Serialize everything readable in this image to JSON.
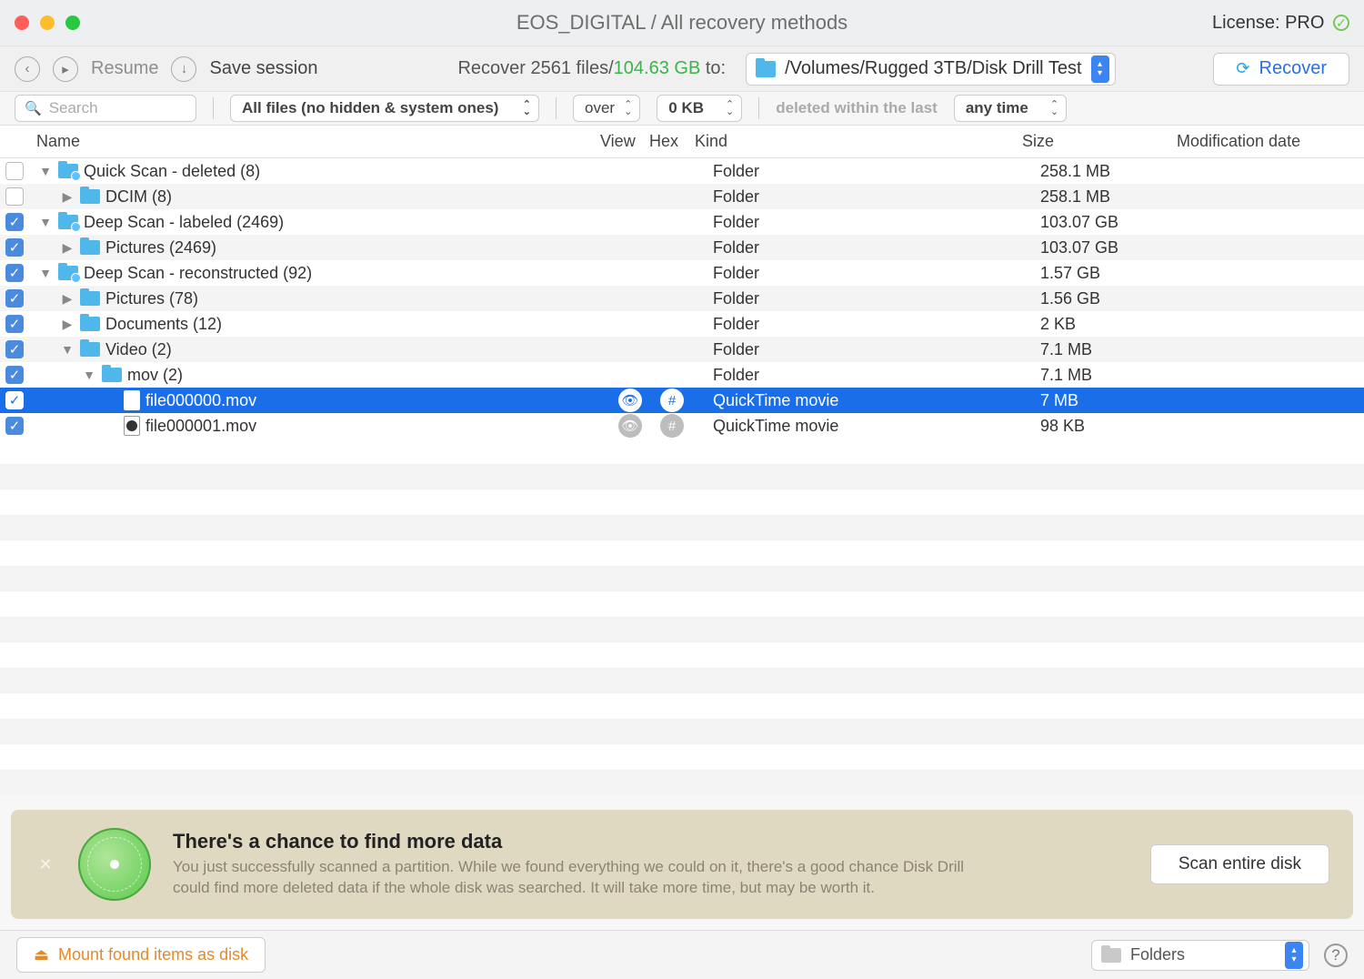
{
  "title": "EOS_DIGITAL / All recovery methods",
  "license": "License: PRO",
  "toolbar": {
    "resume": "Resume",
    "save": "Save session"
  },
  "summary": {
    "prefix": "Recover ",
    "files": "2561 files/",
    "size": "104.63 GB",
    "suffix": " to:"
  },
  "path": "/Volumes/Rugged 3TB/Disk Drill Test",
  "recover_label": "Recover",
  "search_placeholder": "Search",
  "filter_files": "All files (no hidden & system ones)",
  "filter_over": "over",
  "filter_size": "0 KB",
  "filter_deleted": "deleted within the last",
  "filter_time": "any time",
  "columns": {
    "name": "Name",
    "view": "View",
    "hex": "Hex",
    "kind": "Kind",
    "size": "Size",
    "mod": "Modification date"
  },
  "rows": [
    {
      "checked": false,
      "indent": 0,
      "disclosure": "down",
      "icon": "folder-dot",
      "name": "Quick Scan - deleted (8)",
      "kind": "Folder",
      "size": "258.1 MB",
      "selected": false
    },
    {
      "checked": false,
      "indent": 1,
      "disclosure": "right",
      "icon": "folder",
      "name": "DCIM (8)",
      "kind": "Folder",
      "size": "258.1 MB",
      "selected": false
    },
    {
      "checked": true,
      "indent": 0,
      "disclosure": "down",
      "icon": "folder-dot",
      "name": "Deep Scan - labeled (2469)",
      "kind": "Folder",
      "size": "103.07 GB",
      "selected": false
    },
    {
      "checked": true,
      "indent": 1,
      "disclosure": "right",
      "icon": "folder",
      "name": "Pictures (2469)",
      "kind": "Folder",
      "size": "103.07 GB",
      "selected": false
    },
    {
      "checked": true,
      "indent": 0,
      "disclosure": "down",
      "icon": "folder-dot",
      "name": "Deep Scan - reconstructed (92)",
      "kind": "Folder",
      "size": "1.57 GB",
      "selected": false
    },
    {
      "checked": true,
      "indent": 1,
      "disclosure": "right",
      "icon": "folder",
      "name": "Pictures (78)",
      "kind": "Folder",
      "size": "1.56 GB",
      "selected": false
    },
    {
      "checked": true,
      "indent": 1,
      "disclosure": "right",
      "icon": "folder",
      "name": "Documents (12)",
      "kind": "Folder",
      "size": "2 KB",
      "selected": false
    },
    {
      "checked": true,
      "indent": 1,
      "disclosure": "down",
      "icon": "folder",
      "name": "Video (2)",
      "kind": "Folder",
      "size": "7.1 MB",
      "selected": false
    },
    {
      "checked": true,
      "indent": 2,
      "disclosure": "down",
      "icon": "folder",
      "name": "mov (2)",
      "kind": "Folder",
      "size": "7.1 MB",
      "selected": false
    },
    {
      "checked": true,
      "indent": 3,
      "disclosure": "",
      "icon": "file",
      "name": "file000000.mov",
      "kind": "QuickTime movie",
      "size": "7 MB",
      "selected": true,
      "has_icons": true
    },
    {
      "checked": true,
      "indent": 3,
      "disclosure": "",
      "icon": "file",
      "name": "file000001.mov",
      "kind": "QuickTime movie",
      "size": "98 KB",
      "selected": false,
      "has_icons": true
    }
  ],
  "banner": {
    "title": "There's a chance to find more data",
    "body": "You just successfully scanned a partition. While we found everything we could on it, there's a good chance Disk Drill could find more deleted data if the whole disk was searched. It will take more time, but may be worth it.",
    "button": "Scan entire disk"
  },
  "mount_label": "Mount found items as disk",
  "view_mode": "Folders"
}
